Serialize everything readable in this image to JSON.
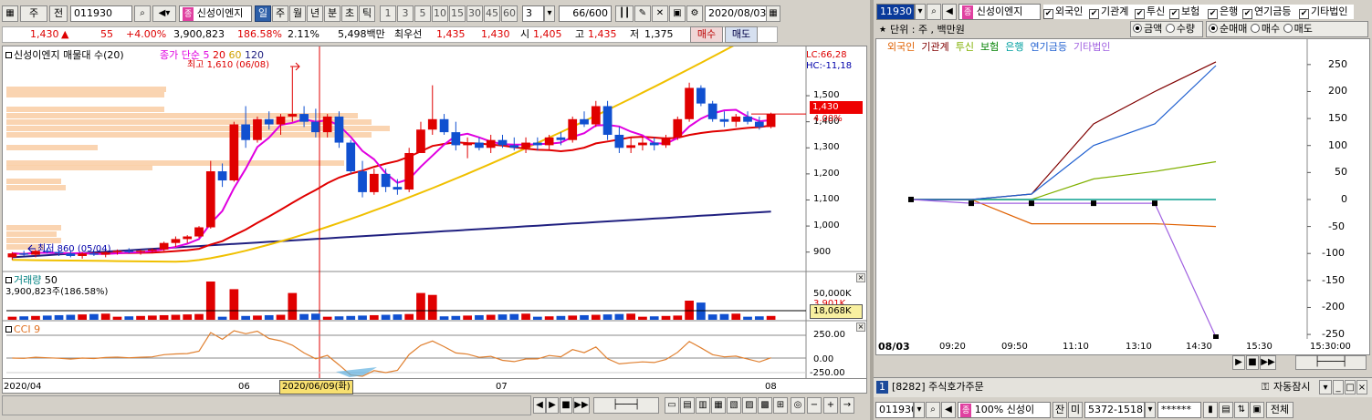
{
  "left": {
    "toolbar": {
      "prefix_btn": "주",
      "market": "전",
      "code": "011930",
      "name": "신성이엔지",
      "periods": [
        "일",
        "주",
        "월",
        "년",
        "분",
        "초",
        "틱"
      ],
      "active_period": "일",
      "intervals": [
        "1",
        "3",
        "5",
        "10",
        "15",
        "30",
        "45",
        "60"
      ],
      "custom_interval": "3",
      "count": "66/600",
      "date": "2020/08/03"
    },
    "quote": {
      "price": "1,430",
      "arrow": "▲",
      "change": "55",
      "change_pct": "+4.00%",
      "volume": "3,900,823",
      "volume_ratio": "186.58%",
      "turnover": "2.11%",
      "amount": "5,498백만",
      "best_ask_label": "최우선",
      "best_ask": "1,435",
      "best_bid": "1,430",
      "open_label": "시",
      "open": "1,405",
      "high_label": "고",
      "high": "1,435",
      "low_label": "저",
      "low": "1,375",
      "buy_label": "매수",
      "sell_label": "매도"
    },
    "price_chart": {
      "legend_title": "신성이엔지 매물대 수(20)",
      "ma_label": "종가 단순",
      "ma_periods": [
        "5",
        "20",
        "60",
        "120"
      ],
      "ma_colors": [
        "#e000e0",
        "#e00000",
        "#f0c000",
        "#202080"
      ],
      "lc": "LC:66,28",
      "hc": "HC:-11,18",
      "high_annot": "최고 1,610 (06/08)",
      "low_annot": "최저 860 (05/04)",
      "y_ticks": [
        "1,500",
        "1,400",
        "1,300",
        "1,200",
        "1,100",
        "1,000",
        "900"
      ],
      "current_price": "1,430",
      "current_pct": "4.00%"
    },
    "volume_chart": {
      "title": "거래량",
      "period": "50",
      "value": "3,900,823주(186.58%)",
      "y_tick": "50,000K",
      "ma_tick": "3,901K",
      "current": "18,068K"
    },
    "cci_chart": {
      "title": "CCI 9",
      "y_ticks": [
        "250.00",
        "0.00",
        "-250.00"
      ]
    },
    "x_axis": {
      "labels": [
        "2020/04",
        "06",
        "07",
        "08"
      ],
      "cursor_label": "2020/06/09(화)"
    }
  },
  "right": {
    "toolbar": {
      "code": "11930",
      "name": "신성이엔지",
      "checks": [
        "외국인",
        "기관계",
        "투신",
        "보험",
        "은행",
        "연기금등",
        "기타법인"
      ]
    },
    "options": {
      "unit": "단위 : 주 , 백만원",
      "radio_a": [
        "금액",
        "수량"
      ],
      "radio_b": [
        "순매매",
        "매수",
        "매도"
      ]
    },
    "chart": {
      "legend": [
        {
          "name": "외국인",
          "color": "#e06000"
        },
        {
          "name": "기관계",
          "color": "#800000"
        },
        {
          "name": "투신",
          "color": "#80b000"
        },
        {
          "name": "보험",
          "color": "#008000"
        },
        {
          "name": "은행",
          "color": "#00a0a0"
        },
        {
          "name": "연기금등",
          "color": "#2060d0"
        },
        {
          "name": "기타법인",
          "color": "#a060e0"
        }
      ],
      "y_ticks": [
        "250",
        "200",
        "150",
        "100",
        "50",
        "0",
        "-50",
        "-100",
        "-150",
        "-200",
        "-250"
      ],
      "x_date": "08/03",
      "x_ticks": [
        "09:20",
        "09:50",
        "11:10",
        "13:10",
        "14:30",
        "15:30",
        "15:30:00"
      ]
    },
    "bottom": {
      "window_no": "1",
      "window_title": "[8282] 주식호가주문",
      "auto_lock": "자동잠시",
      "code": "011930",
      "pct": "100%",
      "name": "신성이",
      "label_jan": "잔",
      "label_mi": "미",
      "account": "5372-1518",
      "password": "******",
      "total_label": "전체"
    }
  },
  "chart_data": [
    {
      "type": "line",
      "x": [
        "09:20",
        "09:50",
        "11:10",
        "13:10",
        "14:30",
        "15:30"
      ],
      "ylim": [
        -260,
        270
      ],
      "series": [
        {
          "name": "외국인",
          "values": [
            0,
            0,
            -45,
            -45,
            -45,
            -50
          ]
        },
        {
          "name": "기관계",
          "values": [
            0,
            0,
            10,
            140,
            200,
            255
          ]
        },
        {
          "name": "투신",
          "values": [
            0,
            0,
            0,
            38,
            52,
            70
          ]
        },
        {
          "name": "보험",
          "values": [
            0,
            0,
            0,
            0,
            0,
            0
          ]
        },
        {
          "name": "은행",
          "values": [
            0,
            0,
            0,
            0,
            0,
            0
          ]
        },
        {
          "name": "연기금등",
          "values": [
            0,
            0,
            10,
            100,
            140,
            248
          ]
        },
        {
          "name": "기타법인",
          "values": [
            0,
            -7,
            -7,
            -7,
            -7,
            -255
          ]
        }
      ]
    },
    {
      "type": "candlestick",
      "ylim": [
        850,
        1640
      ],
      "ohlc": [
        [
          880,
          900,
          870,
          895
        ],
        [
          895,
          905,
          885,
          890
        ],
        [
          890,
          910,
          880,
          905
        ],
        [
          905,
          915,
          895,
          900
        ],
        [
          900,
          905,
          885,
          895
        ],
        [
          895,
          905,
          880,
          885
        ],
        [
          885,
          900,
          875,
          895
        ],
        [
          895,
          905,
          885,
          890
        ],
        [
          890,
          905,
          880,
          900
        ],
        [
          900,
          910,
          890,
          905
        ],
        [
          905,
          915,
          895,
          900
        ],
        [
          900,
          910,
          890,
          905
        ],
        [
          905,
          915,
          895,
          910
        ],
        [
          910,
          940,
          905,
          935
        ],
        [
          935,
          960,
          920,
          950
        ],
        [
          950,
          965,
          935,
          960
        ],
        [
          960,
          1000,
          955,
          995
        ],
        [
          995,
          1250,
          990,
          1210
        ],
        [
          1210,
          1240,
          1150,
          1175
        ],
        [
          1175,
          1400,
          1170,
          1390
        ],
        [
          1390,
          1460,
          1300,
          1330
        ],
        [
          1330,
          1420,
          1320,
          1410
        ],
        [
          1410,
          1440,
          1370,
          1390
        ],
        [
          1390,
          1430,
          1350,
          1420
        ],
        [
          1420,
          1610,
          1400,
          1430
        ],
        [
          1430,
          1460,
          1380,
          1400
        ],
        [
          1400,
          1450,
          1340,
          1360
        ],
        [
          1360,
          1430,
          1340,
          1420
        ],
        [
          1420,
          1440,
          1300,
          1320
        ],
        [
          1320,
          1330,
          1200,
          1210
        ],
        [
          1210,
          1250,
          1110,
          1130
        ],
        [
          1130,
          1220,
          1120,
          1200
        ],
        [
          1200,
          1220,
          1130,
          1150
        ],
        [
          1150,
          1180,
          1120,
          1140
        ],
        [
          1140,
          1300,
          1130,
          1280
        ],
        [
          1280,
          1400,
          1280,
          1370
        ],
        [
          1370,
          1540,
          1350,
          1410
        ],
        [
          1410,
          1430,
          1350,
          1360
        ],
        [
          1360,
          1400,
          1290,
          1310
        ],
        [
          1310,
          1340,
          1260,
          1320
        ],
        [
          1320,
          1340,
          1290,
          1300
        ],
        [
          1300,
          1350,
          1280,
          1330
        ],
        [
          1330,
          1350,
          1300,
          1310
        ],
        [
          1310,
          1340,
          1290,
          1300
        ],
        [
          1300,
          1340,
          1280,
          1320
        ],
        [
          1320,
          1340,
          1290,
          1310
        ],
        [
          1310,
          1350,
          1290,
          1340
        ],
        [
          1340,
          1360,
          1310,
          1330
        ],
        [
          1330,
          1420,
          1320,
          1410
        ],
        [
          1410,
          1440,
          1380,
          1390
        ],
        [
          1390,
          1480,
          1380,
          1460
        ],
        [
          1460,
          1480,
          1330,
          1350
        ],
        [
          1350,
          1380,
          1280,
          1300
        ],
        [
          1300,
          1340,
          1280,
          1310
        ],
        [
          1310,
          1340,
          1290,
          1320
        ],
        [
          1320,
          1340,
          1290,
          1310
        ],
        [
          1310,
          1350,
          1300,
          1340
        ],
        [
          1340,
          1420,
          1330,
          1410
        ],
        [
          1410,
          1550,
          1400,
          1530
        ],
        [
          1530,
          1540,
          1460,
          1470
        ],
        [
          1470,
          1480,
          1400,
          1410
        ],
        [
          1410,
          1440,
          1380,
          1400
        ],
        [
          1400,
          1430,
          1380,
          1420
        ],
        [
          1420,
          1440,
          1390,
          1400
        ],
        [
          1400,
          1420,
          1370,
          1380
        ],
        [
          1380,
          1435,
          1375,
          1430
        ]
      ]
    }
  ]
}
